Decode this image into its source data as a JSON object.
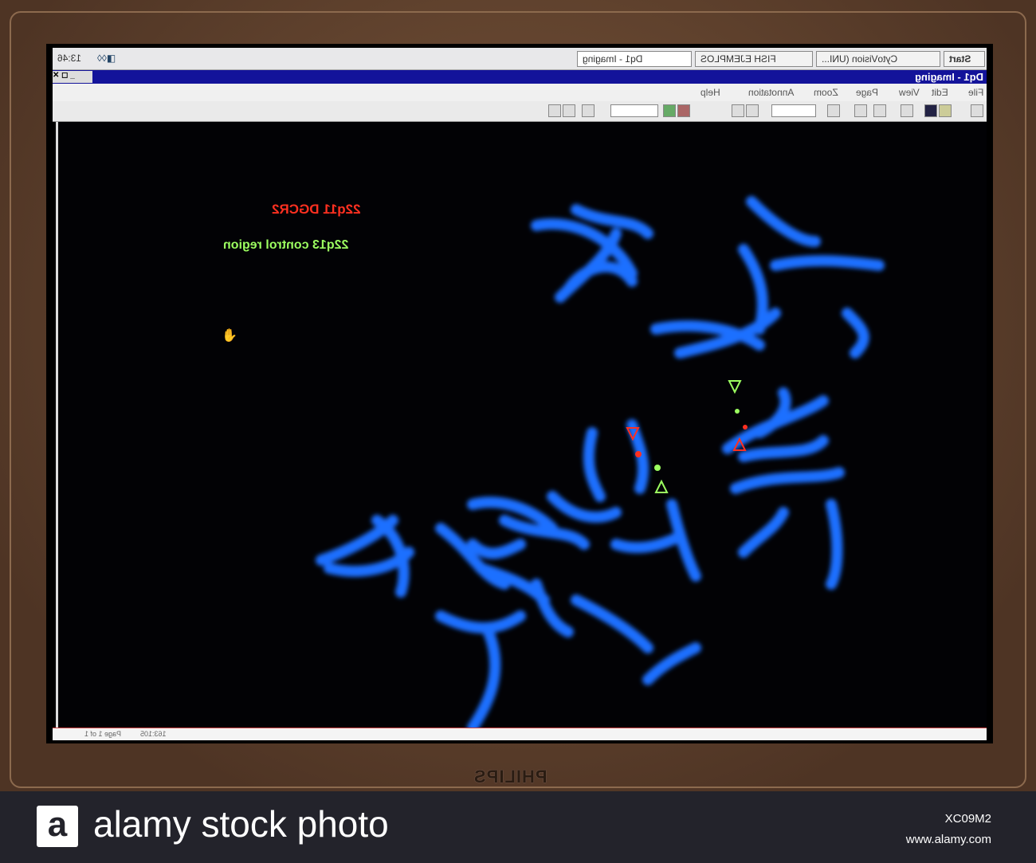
{
  "taskbar": {
    "start": "Start",
    "items": [
      "CytoVision (UNI...",
      "FISH EJEMPLOS",
      "Dq1 - Imaging"
    ],
    "clock": "13:46"
  },
  "window": {
    "title": "Dq1 - Imaging"
  },
  "menu": [
    "File",
    "Edit",
    "View",
    "Page",
    "Zoom",
    "Annotation",
    "Help"
  ],
  "annotations": {
    "probe1": "22q11 DGCR2",
    "probe2": "22q13 control region"
  },
  "status": {
    "page": "Page 1 of 1",
    "coords": "163:105"
  },
  "monitor": {
    "brand": "PHILIPS"
  },
  "footer": {
    "logo": "a",
    "text": "alamy stock photo",
    "code": "XC09M2",
    "url": "www.alamy.com"
  },
  "colors": {
    "chromosome": "#1e6fff",
    "probe_red": "#ff3020",
    "probe_green": "#9cff60",
    "titlebar": "#13139a"
  }
}
